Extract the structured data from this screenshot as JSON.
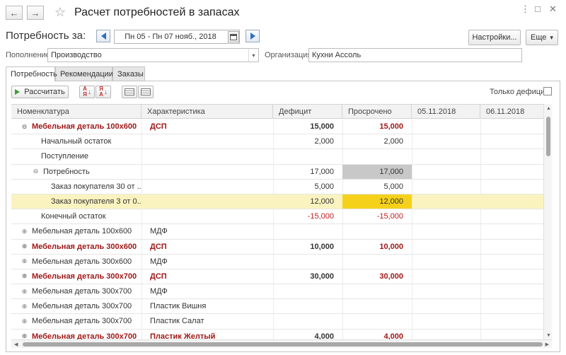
{
  "window": {
    "title": "Расчет потребностей в запасах",
    "back": "←",
    "forward": "→",
    "star": "☆",
    "more": "⋮",
    "maximize": "□",
    "close": "✕"
  },
  "header": {
    "period_label": "Потребность за:",
    "period_value": "Пн 05 - Пн 07 нояб., 2018",
    "settings_label": "Настройки...",
    "more_label": "Еще",
    "more_caret": "▾"
  },
  "fields": {
    "replenishment_label": "Пополнение:",
    "replenishment_value": "Производство",
    "dropdown_caret": "▾",
    "organization_label": "Организация:",
    "organization_value": "Кухни Ассоль"
  },
  "tabs": [
    {
      "label": "Потребность"
    },
    {
      "label": "Рекомендации"
    },
    {
      "label": "Заказы"
    }
  ],
  "toolbar": {
    "calculate_label": "Рассчитать",
    "only_deficit_label": "Только дефицит:"
  },
  "table": {
    "columns": [
      "Номенклатура",
      "Характеристика",
      "Дефицит",
      "Просрочено",
      "05.11.2018",
      "06.11.2018"
    ],
    "rows": [
      {
        "name": "Мебельная деталь 100x600",
        "char": "ДСП",
        "deficit": "15,000",
        "overdue": "15,000",
        "d1": "",
        "d2": "",
        "level": 0,
        "toggle": "⊖",
        "style": "redbold"
      },
      {
        "name": "Начальный остаток",
        "char": "",
        "deficit": "2,000",
        "overdue": "2,000",
        "d1": "",
        "d2": "",
        "level": 1,
        "toggle": "",
        "style": "normal"
      },
      {
        "name": "Поступление",
        "char": "",
        "deficit": "",
        "overdue": "",
        "d1": "",
        "d2": "",
        "level": 1,
        "toggle": "",
        "style": "normal"
      },
      {
        "name": "Потребность",
        "char": "",
        "deficit": "17,000",
        "overdue": "17,000",
        "d1": "",
        "d2": "",
        "level": 1,
        "toggle": "⊖",
        "style": "normal",
        "overdue_cell": "gray"
      },
      {
        "name": "Заказ покупателя 30 от ...",
        "char": "",
        "deficit": "5,000",
        "overdue": "5,000",
        "d1": "",
        "d2": "",
        "level": 2,
        "toggle": "",
        "style": "normal"
      },
      {
        "name": "Заказ покупателя 3 от 0...",
        "char": "",
        "deficit": "12,000",
        "overdue": "12,000",
        "d1": "",
        "d2": "",
        "level": 2,
        "toggle": "",
        "style": "normal",
        "highlight": true,
        "overdue_cell": "yellow"
      },
      {
        "name": "Конечный остаток",
        "char": "",
        "deficit": "-15,000",
        "overdue": "-15,000",
        "d1": "",
        "d2": "",
        "level": 1,
        "toggle": "",
        "style": "neg"
      },
      {
        "name": "Мебельная деталь 100x600",
        "char": "МДФ",
        "deficit": "",
        "overdue": "",
        "d1": "",
        "d2": "",
        "level": 0,
        "toggle": "⊕",
        "style": "normal"
      },
      {
        "name": "Мебельная деталь 300x600",
        "char": "ДСП",
        "deficit": "10,000",
        "overdue": "10,000",
        "d1": "",
        "d2": "",
        "level": 0,
        "toggle": "⊕",
        "style": "redbold"
      },
      {
        "name": "Мебельная деталь 300x600",
        "char": "МДФ",
        "deficit": "",
        "overdue": "",
        "d1": "",
        "d2": "",
        "level": 0,
        "toggle": "⊕",
        "style": "normal"
      },
      {
        "name": "Мебельная деталь 300x700",
        "char": "ДСП",
        "deficit": "30,000",
        "overdue": "30,000",
        "d1": "",
        "d2": "",
        "level": 0,
        "toggle": "⊕",
        "style": "redbold"
      },
      {
        "name": "Мебельная деталь 300x700",
        "char": "МДФ",
        "deficit": "",
        "overdue": "",
        "d1": "",
        "d2": "",
        "level": 0,
        "toggle": "⊕",
        "style": "normal"
      },
      {
        "name": "Мебельная деталь 300x700",
        "char": "Пластик Вишня",
        "deficit": "",
        "overdue": "",
        "d1": "",
        "d2": "",
        "level": 0,
        "toggle": "⊕",
        "style": "normal"
      },
      {
        "name": "Мебельная деталь 300x700",
        "char": "Пластик Салат",
        "deficit": "",
        "overdue": "",
        "d1": "",
        "d2": "",
        "level": 0,
        "toggle": "⊕",
        "style": "normal"
      },
      {
        "name": "Мебельная деталь 300x700",
        "char": "Пластик Желтый",
        "deficit": "4,000",
        "overdue": "4,000",
        "d1": "",
        "d2": "",
        "level": 0,
        "toggle": "⊕",
        "style": "redbold"
      }
    ]
  },
  "colors": {
    "accent_blue": "#2f6fc4",
    "dark_red": "#a01818",
    "highlight_row": "#faf3bf",
    "highlight_cell": "#f5d11c",
    "gray_cell": "#c8c8c8"
  }
}
